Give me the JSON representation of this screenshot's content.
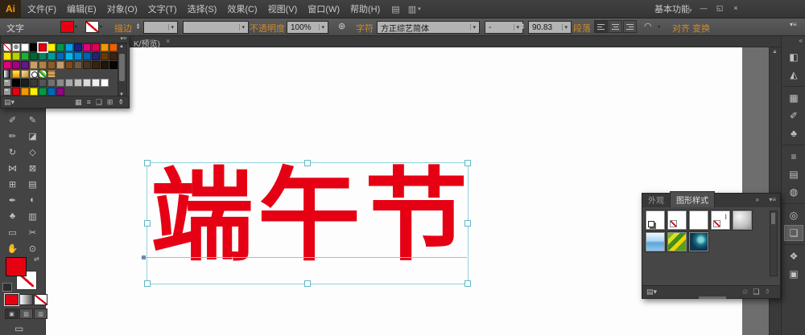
{
  "titlebar": {
    "logo": "Ai",
    "menus": [
      "文件(F)",
      "编辑(E)",
      "对象(O)",
      "文字(T)",
      "选择(S)",
      "效果(C)",
      "视图(V)",
      "窗口(W)",
      "帮助(H)"
    ],
    "workspace": "基本功能",
    "minimize": "—",
    "restore": "◱",
    "close": "×"
  },
  "control_bar": {
    "object_label": "文字",
    "stroke_label": "描边",
    "opacity_label": "不透明度",
    "opacity_value": "100%",
    "character_label": "字符",
    "font_name": "方正综艺简体",
    "font_style": "-",
    "font_size": "90.83",
    "paragraph_label": "段落",
    "align_label": "对齐",
    "transform_label": "变换"
  },
  "document": {
    "tab_text": "K/预览)",
    "tab_close": "×"
  },
  "canvas": {
    "artwork_text": "端午节",
    "artwork_color": "#e60014"
  },
  "colors": {
    "accent_red": "#e60012",
    "link_orange": "#cf8a2b",
    "selection_cyan": "#8ed1da"
  },
  "icons": {
    "panel_menu": "▾≡",
    "caret": "▾",
    "up_arrow": "▲",
    "down_arrow": "▼",
    "collapse": "«",
    "expand": "»",
    "app_icon_bridge": "▤",
    "app_icon_arrange": "▥",
    "recolor_artwork": "⊛",
    "envelope_warp": "◠",
    "library": "▤▾",
    "show_kinds": "▦",
    "options": "≡",
    "new_group": "❑",
    "new_item": "⊞",
    "trash": "⚱",
    "break_link": "⊘",
    "new_style": "❏",
    "swap": "⇄",
    "screen_mode": "▭"
  },
  "swatches_panel": {
    "selected": {
      "row": 0,
      "col": 4
    },
    "rows": [
      [
        "none",
        "reg",
        "#ffffff",
        "#000000",
        "#e60012",
        "#fff100",
        "#009944",
        "#00a0e9",
        "#1d2088",
        "#e4007f",
        "#e5004f",
        "#f39800",
        "#eb6100"
      ],
      [
        "#ffe100",
        "#b8d200",
        "#22ac38",
        "#006934",
        "#00885f",
        "#009e96",
        "#0068b7",
        "#00b7ee",
        "#008cd6",
        "#0062ac",
        "#20256c",
        "#6a3906",
        "#3e220f"
      ],
      [
        "#e4007f",
        "#a40081",
        "#601986",
        "#c9a063",
        "#b28247",
        "#8a5d2e",
        "#c59b6d",
        "#7b4a1e",
        "#6e5a43",
        "#4a3420",
        "#35240f",
        "#221507",
        "#070302"
      ],
      [
        "grad-bw",
        "grad-yellow",
        "grad-gold",
        "pat-circle",
        "pat-green",
        "pat-tan"
      ],
      [
        "group",
        "#000000",
        "#1e1e1e",
        "#3a3a3a",
        "#555555",
        "#707070",
        "#8c8c8c",
        "#a7a7a7",
        "#c2c2c2",
        "#dddddd",
        "#efefef",
        "#ffffff"
      ],
      [
        "group",
        "#e60012",
        "#f39800",
        "#fff100",
        "#009944",
        "#0068b7",
        "#920783"
      ]
    ]
  },
  "toolbar": {
    "tools": [
      [
        "paintbrush",
        "✐"
      ],
      [
        "pencil",
        "✎"
      ],
      [
        "blob-brush",
        "✏"
      ],
      [
        "eraser",
        "◪"
      ],
      [
        "rotate",
        "↻"
      ],
      [
        "free-transform",
        "◇"
      ],
      [
        "width",
        "⋈"
      ],
      [
        "shape-builder",
        "⊠"
      ],
      [
        "mesh",
        "⊞"
      ],
      [
        "gradient",
        "▤"
      ],
      [
        "eyedropper",
        "✒"
      ],
      [
        "blend",
        "◐"
      ],
      [
        "symbol-sprayer",
        "♣"
      ],
      [
        "column-graph",
        "▥"
      ],
      [
        "artboard",
        "▭"
      ],
      [
        "slice",
        "✂"
      ],
      [
        "hand",
        "✋"
      ],
      [
        "zoom",
        "⊙"
      ]
    ]
  },
  "graphic_styles_panel": {
    "tabs": [
      {
        "label": "外观"
      },
      {
        "label": "图形样式"
      }
    ],
    "styles": [
      {
        "name": "default-graphic-style",
        "type": "default"
      },
      {
        "name": "no-fill-style",
        "type": "nofill"
      },
      {
        "name": "white-style",
        "type": "plain"
      },
      {
        "name": "text-default-style",
        "type": "textnone"
      },
      {
        "name": "silver-bevel-style",
        "type": "silver"
      },
      {
        "name": "blue-glass-style",
        "type": "blueglass"
      },
      {
        "name": "leaf-pattern-style",
        "type": "leaf"
      },
      {
        "name": "teal-swirl-style",
        "type": "swirl"
      }
    ]
  },
  "right_dock": {
    "items": [
      {
        "name": "color",
        "glyph": "◧"
      },
      {
        "name": "color-guide",
        "glyph": "◭"
      },
      {
        "sep": true
      },
      {
        "name": "swatches",
        "glyph": "▦"
      },
      {
        "name": "brushes",
        "glyph": "✐"
      },
      {
        "name": "symbols",
        "glyph": "♣"
      },
      {
        "sep": true
      },
      {
        "name": "stroke",
        "glyph": "≡"
      },
      {
        "name": "gradient",
        "glyph": "▤"
      },
      {
        "name": "transparency",
        "glyph": "◍"
      },
      {
        "sep": true
      },
      {
        "name": "appearance",
        "glyph": "◎"
      },
      {
        "name": "graphic-styles",
        "glyph": "❏",
        "active": true
      },
      {
        "sep": true
      },
      {
        "name": "layers",
        "glyph": "❖"
      },
      {
        "name": "artboards",
        "glyph": "▣"
      }
    ]
  }
}
